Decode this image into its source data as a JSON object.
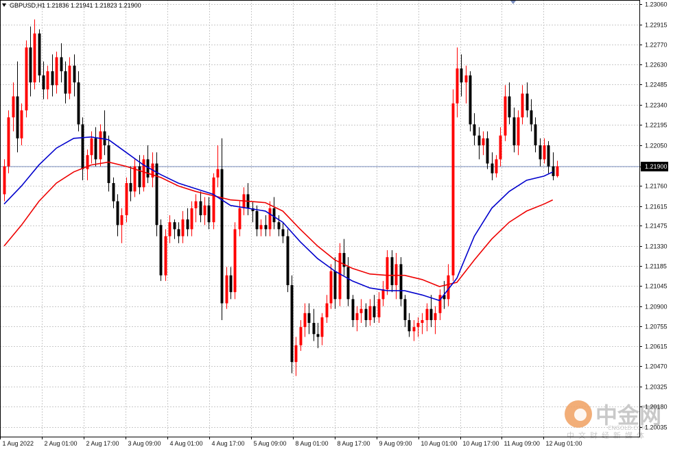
{
  "header": {
    "symbol": "GBPUSD,H1",
    "ohlc": "1.21836 1.21941 1.21823 1.21900"
  },
  "colors": {
    "bull": "#ff0000",
    "bear": "#000000",
    "ma_fast": "#0000cc",
    "ma_slow": "#ee0000",
    "grid": "#c8c8c8",
    "bid_line": "#7b8fbf",
    "price_tag_bg": "#000000",
    "price_tag_fg": "#ffffff"
  },
  "current_price": "1.21900",
  "watermark": {
    "brand": "中金网",
    "domain": "CNGOLD.COM",
    "tagline": "中文财经新媒体"
  },
  "chart_data": {
    "type": "candlestick",
    "symbol": "GBPUSD",
    "timeframe": "H1",
    "ylim": [
      1.20035,
      1.2306
    ],
    "y_ticks": [
      "1.23060",
      "1.22915",
      "1.22770",
      "1.22630",
      "1.22485",
      "1.22340",
      "1.22195",
      "1.22050",
      "1.21900",
      "1.21760",
      "1.21615",
      "1.21475",
      "1.21330",
      "1.21185",
      "1.21045",
      "1.20900",
      "1.20755",
      "1.20615",
      "1.20470",
      "1.20325",
      "1.20180",
      "1.20035"
    ],
    "x_ticks": [
      "1 Aug 2022",
      "2 Aug 01:00",
      "2 Aug 17:00",
      "3 Aug 09:00",
      "4 Aug 01:00",
      "4 Aug 17:00",
      "5 Aug 09:00",
      "8 Aug 01:00",
      "8 Aug 17:00",
      "9 Aug 09:00",
      "10 Aug 01:00",
      "10 Aug 17:00",
      "11 Aug 09:00",
      "12 Aug 01:00"
    ],
    "bar_spacing_hours": 1,
    "ohlc": [
      [
        1.217,
        1.2195,
        1.2165,
        1.219
      ],
      [
        1.219,
        1.223,
        1.2185,
        1.2225
      ],
      [
        1.2225,
        1.225,
        1.2215,
        1.224
      ],
      [
        1.224,
        1.2265,
        1.22,
        1.221
      ],
      [
        1.221,
        1.2235,
        1.2205,
        1.223
      ],
      [
        1.223,
        1.228,
        1.2225,
        1.2275
      ],
      [
        1.2275,
        1.229,
        1.224,
        1.225
      ],
      [
        1.225,
        1.2295,
        1.2245,
        1.2285
      ],
      [
        1.2285,
        1.2288,
        1.225,
        1.2255
      ],
      [
        1.2255,
        1.2265,
        1.2238,
        1.2245
      ],
      [
        1.2245,
        1.2262,
        1.2238,
        1.2258
      ],
      [
        1.2258,
        1.227,
        1.224,
        1.2248
      ],
      [
        1.2248,
        1.2272,
        1.2242,
        1.2268
      ],
      [
        1.2268,
        1.2278,
        1.225,
        1.2258
      ],
      [
        1.2258,
        1.2265,
        1.2235,
        1.2242
      ],
      [
        1.2242,
        1.2268,
        1.2238,
        1.2262
      ],
      [
        1.2262,
        1.227,
        1.224,
        1.225
      ],
      [
        1.225,
        1.2258,
        1.2215,
        1.222
      ],
      [
        1.222,
        1.2225,
        1.218,
        1.2188
      ],
      [
        1.2188,
        1.2202,
        1.218,
        1.2198
      ],
      [
        1.2198,
        1.2215,
        1.2192,
        1.221
      ],
      [
        1.221,
        1.2218,
        1.219,
        1.2195
      ],
      [
        1.2195,
        1.222,
        1.219,
        1.2215
      ],
      [
        1.2215,
        1.223,
        1.2198,
        1.2205
      ],
      [
        1.2205,
        1.2212,
        1.2172,
        1.2178
      ],
      [
        1.2178,
        1.2182,
        1.216,
        1.2165
      ],
      [
        1.2165,
        1.217,
        1.214,
        1.2148
      ],
      [
        1.2148,
        1.216,
        1.2135,
        1.2155
      ],
      [
        1.2155,
        1.2182,
        1.215,
        1.2178
      ],
      [
        1.2178,
        1.219,
        1.2165,
        1.2172
      ],
      [
        1.2172,
        1.2195,
        1.2168,
        1.219
      ],
      [
        1.219,
        1.2198,
        1.217,
        1.2175
      ],
      [
        1.2175,
        1.2198,
        1.2172,
        1.2195
      ],
      [
        1.2195,
        1.2205,
        1.2178,
        1.2182
      ],
      [
        1.2182,
        1.22,
        1.2175,
        1.2192
      ],
      [
        1.2192,
        1.22,
        1.214,
        1.2148
      ],
      [
        1.2148,
        1.2152,
        1.2108,
        1.2112
      ],
      [
        1.2112,
        1.2145,
        1.2108,
        1.214
      ],
      [
        1.214,
        1.2155,
        1.2135,
        1.215
      ],
      [
        1.215,
        1.2152,
        1.2138,
        1.2145
      ],
      [
        1.2145,
        1.215,
        1.2135,
        1.214
      ],
      [
        1.214,
        1.2158,
        1.2135,
        1.2152
      ],
      [
        1.2152,
        1.216,
        1.214,
        1.2145
      ],
      [
        1.2145,
        1.2165,
        1.214,
        1.216
      ],
      [
        1.216,
        1.217,
        1.215,
        1.2165
      ],
      [
        1.2165,
        1.2172,
        1.215,
        1.2155
      ],
      [
        1.2155,
        1.2168,
        1.2148,
        1.2162
      ],
      [
        1.2162,
        1.2168,
        1.2145,
        1.215
      ],
      [
        1.215,
        1.2185,
        1.2145,
        1.2182
      ],
      [
        1.2182,
        1.2205,
        1.2175,
        1.2188
      ],
      [
        1.2188,
        1.221,
        1.208,
        1.2092
      ],
      [
        1.2092,
        1.2118,
        1.2088,
        1.2112
      ],
      [
        1.2112,
        1.2118,
        1.2095,
        1.21
      ],
      [
        1.21,
        1.215,
        1.2095,
        1.2145
      ],
      [
        1.2145,
        1.2165,
        1.214,
        1.216
      ],
      [
        1.216,
        1.2175,
        1.2155,
        1.217
      ],
      [
        1.217,
        1.2178,
        1.2155,
        1.216
      ],
      [
        1.216,
        1.2165,
        1.215,
        1.2158
      ],
      [
        1.2158,
        1.2162,
        1.214,
        1.2145
      ],
      [
        1.2145,
        1.2152,
        1.214,
        1.2148
      ],
      [
        1.2148,
        1.2155,
        1.214,
        1.2145
      ],
      [
        1.2145,
        1.2165,
        1.214,
        1.216
      ],
      [
        1.216,
        1.2168,
        1.2145,
        1.215
      ],
      [
        1.215,
        1.2155,
        1.214,
        1.2145
      ],
      [
        1.2145,
        1.215,
        1.2135,
        1.214
      ],
      [
        1.214,
        1.2145,
        1.21,
        1.2105
      ],
      [
        1.2105,
        1.2112,
        1.2042,
        1.205
      ],
      [
        1.205,
        1.2068,
        1.204,
        1.2062
      ],
      [
        1.2062,
        1.208,
        1.2058,
        1.2075
      ],
      [
        1.2075,
        1.2092,
        1.2068,
        1.2085
      ],
      [
        1.2085,
        1.2092,
        1.207,
        1.2078
      ],
      [
        1.2078,
        1.2088,
        1.2065,
        1.207
      ],
      [
        1.207,
        1.2078,
        1.206,
        1.2068
      ],
      [
        1.2068,
        1.2085,
        1.2062,
        1.2082
      ],
      [
        1.2082,
        1.2098,
        1.2078,
        1.2092
      ],
      [
        1.2092,
        1.212,
        1.2088,
        1.2115
      ],
      [
        1.2115,
        1.2125,
        1.2088,
        1.2095
      ],
      [
        1.2095,
        1.2135,
        1.209,
        1.2128
      ],
      [
        1.2128,
        1.2138,
        1.2112,
        1.2118
      ],
      [
        1.2118,
        1.2125,
        1.209,
        1.2095
      ],
      [
        1.2095,
        1.2098,
        1.2075,
        1.208
      ],
      [
        1.208,
        1.209,
        1.2072,
        1.2085
      ],
      [
        1.2085,
        1.2095,
        1.2078,
        1.2088
      ],
      [
        1.2088,
        1.2092,
        1.2075,
        1.208
      ],
      [
        1.208,
        1.2095,
        1.2076,
        1.209
      ],
      [
        1.209,
        1.2098,
        1.2078,
        1.2082
      ],
      [
        1.2082,
        1.21,
        1.2078,
        1.2095
      ],
      [
        1.2095,
        1.2108,
        1.209,
        1.2102
      ],
      [
        1.2102,
        1.213,
        1.2098,
        1.2125
      ],
      [
        1.2125,
        1.213,
        1.21,
        1.2105
      ],
      [
        1.2105,
        1.2128,
        1.2095,
        1.212
      ],
      [
        1.212,
        1.2125,
        1.209,
        1.2095
      ],
      [
        1.2095,
        1.2098,
        1.2075,
        1.208
      ],
      [
        1.208,
        1.2085,
        1.2068,
        1.2072
      ],
      [
        1.2072,
        1.208,
        1.2065,
        1.2075
      ],
      [
        1.2075,
        1.2082,
        1.2068,
        1.2078
      ],
      [
        1.2078,
        1.2085,
        1.207,
        1.208
      ],
      [
        1.208,
        1.2092,
        1.2072,
        1.2088
      ],
      [
        1.2088,
        1.2098,
        1.2075,
        1.208
      ],
      [
        1.208,
        1.209,
        1.207,
        1.2085
      ],
      [
        1.2085,
        1.2102,
        1.208,
        1.2098
      ],
      [
        1.2098,
        1.2108,
        1.2088,
        1.2095
      ],
      [
        1.2095,
        1.212,
        1.209,
        1.2112
      ],
      [
        1.2112,
        1.2245,
        1.2108,
        1.2235
      ],
      [
        1.2235,
        1.2275,
        1.2225,
        1.226
      ],
      [
        1.226,
        1.227,
        1.224,
        1.225
      ],
      [
        1.225,
        1.2262,
        1.2235,
        1.2255
      ],
      [
        1.2255,
        1.2258,
        1.2215,
        1.222
      ],
      [
        1.222,
        1.2228,
        1.2205,
        1.2212
      ],
      [
        1.2212,
        1.2218,
        1.2195,
        1.2205
      ],
      [
        1.2205,
        1.2215,
        1.2198,
        1.221
      ],
      [
        1.221,
        1.2215,
        1.2188,
        1.2192
      ],
      [
        1.2192,
        1.22,
        1.218,
        1.2185
      ],
      [
        1.2185,
        1.2198,
        1.2182,
        1.2195
      ],
      [
        1.2195,
        1.2218,
        1.219,
        1.2212
      ],
      [
        1.2212,
        1.2248,
        1.2208,
        1.224
      ],
      [
        1.224,
        1.225,
        1.222,
        1.2225
      ],
      [
        1.2225,
        1.2232,
        1.22,
        1.2205
      ],
      [
        1.2205,
        1.223,
        1.2198,
        1.2225
      ],
      [
        1.2225,
        1.2248,
        1.222,
        1.2242
      ],
      [
        1.2242,
        1.225,
        1.2225,
        1.223
      ],
      [
        1.223,
        1.2238,
        1.2215,
        1.222
      ],
      [
        1.222,
        1.2225,
        1.22,
        1.2205
      ],
      [
        1.2205,
        1.221,
        1.219,
        1.2195
      ],
      [
        1.2195,
        1.221,
        1.2192,
        1.2205
      ],
      [
        1.2205,
        1.2208,
        1.2185,
        1.219
      ],
      [
        1.219,
        1.22,
        1.218,
        1.2183
      ],
      [
        1.2183,
        1.2194,
        1.2182,
        1.219
      ]
    ],
    "ma_fast": [
      [
        0,
        1.2163
      ],
      [
        4,
        1.2176
      ],
      [
        8,
        1.2191
      ],
      [
        12,
        1.2203
      ],
      [
        16,
        1.221
      ],
      [
        20,
        1.2211
      ],
      [
        24,
        1.2209
      ],
      [
        28,
        1.22
      ],
      [
        32,
        1.2191
      ],
      [
        36,
        1.2184
      ],
      [
        40,
        1.2178
      ],
      [
        44,
        1.2174
      ],
      [
        48,
        1.217
      ],
      [
        52,
        1.2162
      ],
      [
        56,
        1.216
      ],
      [
        60,
        1.2158
      ],
      [
        64,
        1.215
      ],
      [
        68,
        1.2136
      ],
      [
        72,
        1.2124
      ],
      [
        76,
        1.2115
      ],
      [
        80,
        1.2108
      ],
      [
        84,
        1.2103
      ],
      [
        88,
        1.2101
      ],
      [
        92,
        1.2101
      ],
      [
        96,
        1.2098
      ],
      [
        100,
        1.2094
      ],
      [
        104,
        1.211
      ],
      [
        108,
        1.214
      ],
      [
        112,
        1.216
      ],
      [
        116,
        1.2172
      ],
      [
        120,
        1.218
      ],
      [
        124,
        1.2183
      ],
      [
        126,
        1.2186
      ]
    ],
    "ma_slow": [
      [
        0,
        1.2133
      ],
      [
        4,
        1.2148
      ],
      [
        8,
        1.2165
      ],
      [
        12,
        1.2178
      ],
      [
        16,
        1.2186
      ],
      [
        20,
        1.2191
      ],
      [
        24,
        1.2193
      ],
      [
        28,
        1.219
      ],
      [
        32,
        1.2186
      ],
      [
        36,
        1.2182
      ],
      [
        40,
        1.2176
      ],
      [
        44,
        1.2172
      ],
      [
        48,
        1.2169
      ],
      [
        52,
        1.2166
      ],
      [
        56,
        1.2165
      ],
      [
        60,
        1.2164
      ],
      [
        64,
        1.2158
      ],
      [
        68,
        1.2145
      ],
      [
        72,
        1.2133
      ],
      [
        76,
        1.2123
      ],
      [
        80,
        1.2117
      ],
      [
        84,
        1.2113
      ],
      [
        88,
        1.2112
      ],
      [
        92,
        1.2112
      ],
      [
        96,
        1.2109
      ],
      [
        100,
        1.2104
      ],
      [
        104,
        1.2107
      ],
      [
        108,
        1.2123
      ],
      [
        112,
        1.2138
      ],
      [
        116,
        1.215
      ],
      [
        120,
        1.2158
      ],
      [
        124,
        1.2163
      ],
      [
        126,
        1.2166
      ]
    ]
  }
}
